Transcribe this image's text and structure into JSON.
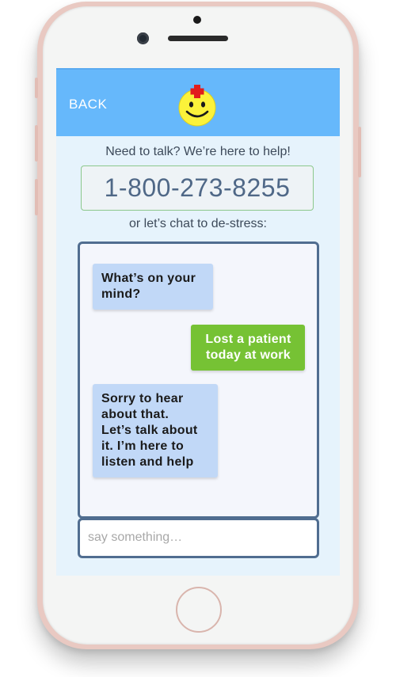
{
  "header": {
    "back_label": "BACK",
    "logo_icon": "smiley-nurse-icon"
  },
  "help": {
    "prompt": "Need to talk? We’re here to help!",
    "hotline": "1-800-273-8255",
    "chat_prompt": "or let’s chat to de-stress:"
  },
  "chat": {
    "messages": [
      {
        "sender": "bot",
        "text": "What’s on your\nmind?"
      },
      {
        "sender": "user",
        "text": "Lost a patient\ntoday at work"
      },
      {
        "sender": "bot",
        "text": "Sorry to hear\nabout that.\nLet’s talk about\nit. I’m here to\nlisten and help"
      }
    ]
  },
  "input": {
    "placeholder": "say something…",
    "value": ""
  },
  "colors": {
    "header": "#66b8fb",
    "bot_bubble": "#c1d8f7",
    "user_bubble": "#76c234",
    "frame": "#506d90",
    "phone_shell": "#e9c9c2"
  }
}
